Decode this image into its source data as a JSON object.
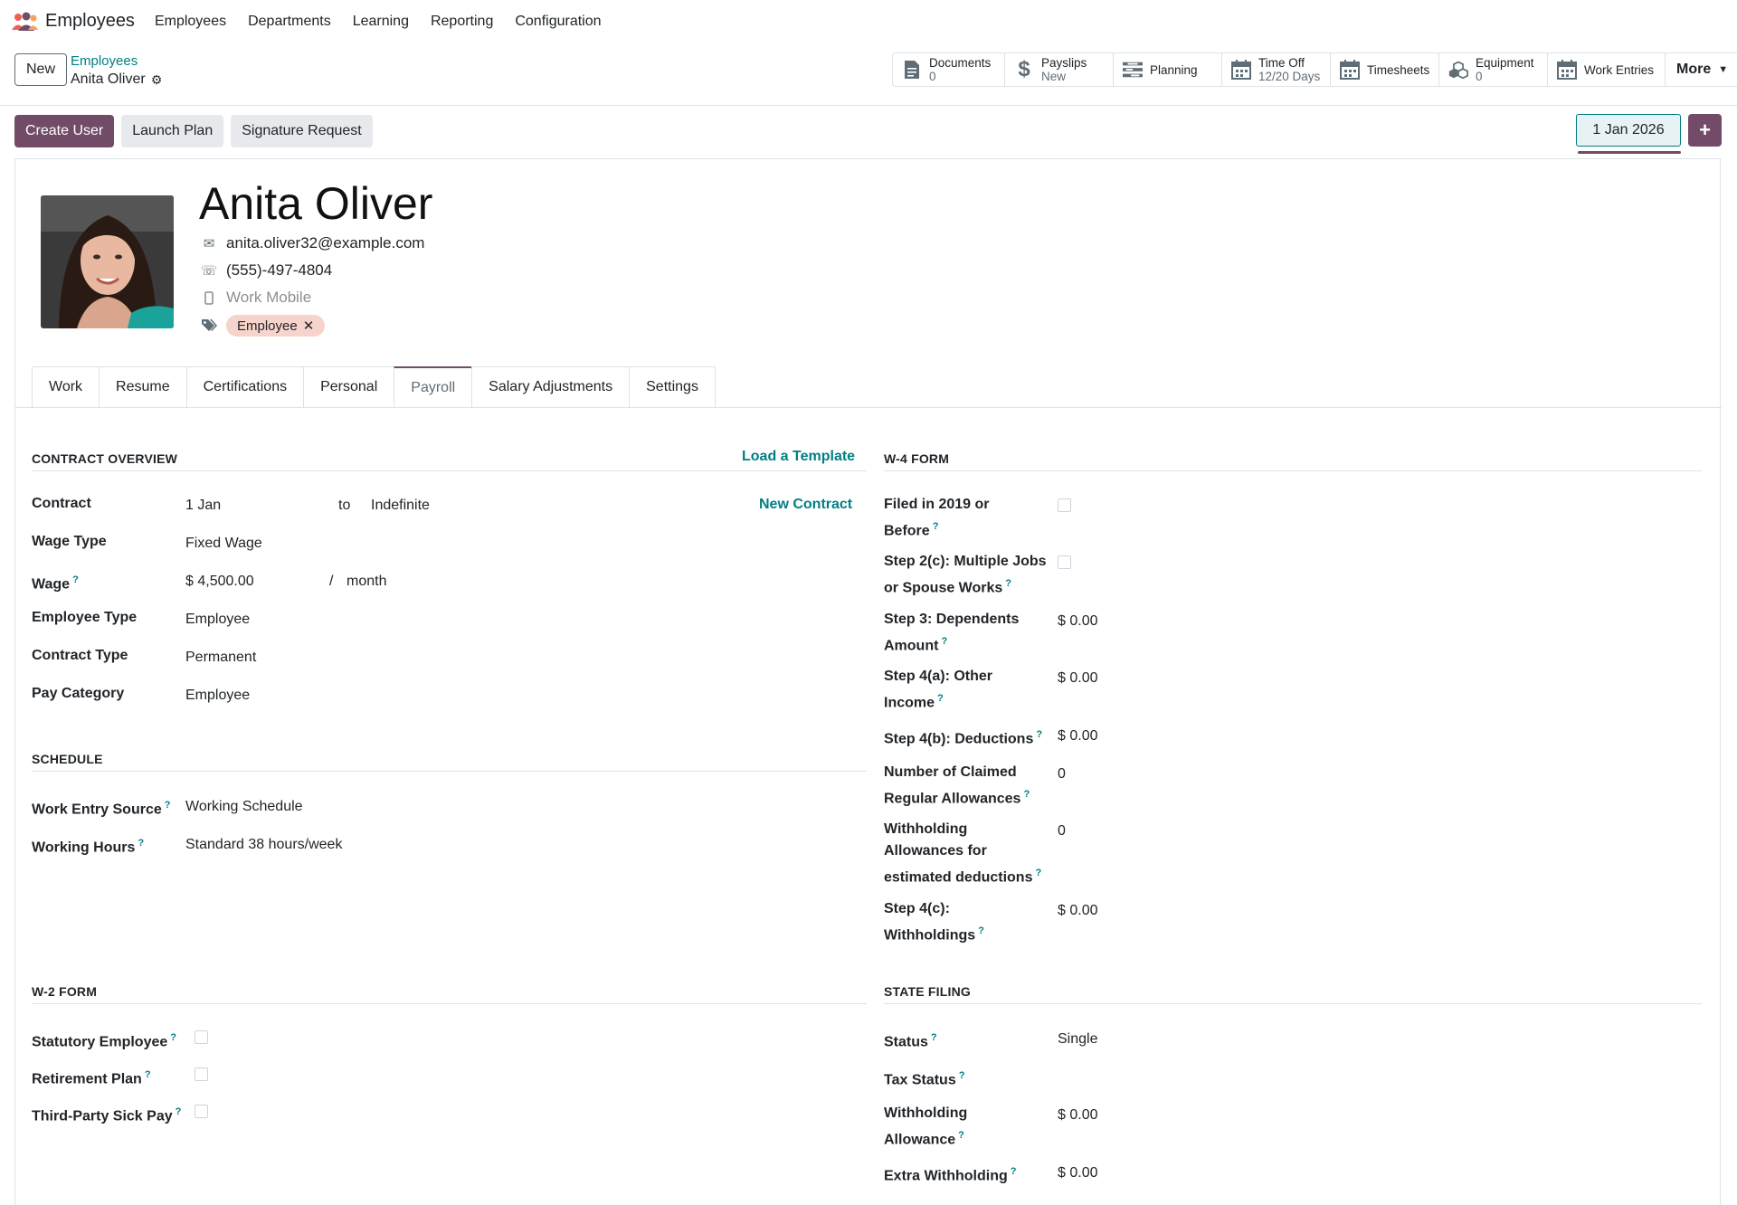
{
  "app": {
    "title": "Employees"
  },
  "nav": [
    "Employees",
    "Departments",
    "Learning",
    "Reporting",
    "Configuration"
  ],
  "control": {
    "new_label": "New",
    "breadcrumb_parent": "Employees",
    "breadcrumb_current": "Anita Oliver"
  },
  "smart_buttons": [
    {
      "label": "Documents",
      "value": "0",
      "icon": "document-icon"
    },
    {
      "label": "Payslips",
      "value": "New",
      "icon": "dollar-icon"
    },
    {
      "label": "Planning",
      "value": "",
      "icon": "planning-icon"
    },
    {
      "label": "Time Off",
      "value": "12/20 Days",
      "icon": "calendar-icon"
    },
    {
      "label": "Timesheets",
      "value": "",
      "icon": "calendar-icon"
    },
    {
      "label": "Equipment",
      "value": "0",
      "icon": "cubes-icon"
    },
    {
      "label": "Work Entries",
      "value": "",
      "icon": "calendar-icon"
    },
    {
      "label": "More",
      "value": "",
      "icon": "caret-down-icon"
    }
  ],
  "actions": {
    "create_user": "Create User",
    "launch_plan": "Launch Plan",
    "signature_request": "Signature Request",
    "date": "1 Jan 2026",
    "plus": "+"
  },
  "employee": {
    "name": "Anita Oliver",
    "email": "anita.oliver32@example.com",
    "phone": "(555)-497-4804",
    "mobile_placeholder": "Work Mobile",
    "tag": "Employee",
    "tag_remove": "✕"
  },
  "tabs": [
    "Work",
    "Resume",
    "Certifications",
    "Personal",
    "Payroll",
    "Salary Adjustments",
    "Settings"
  ],
  "active_tab": "Payroll",
  "contract_overview": {
    "title": "CONTRACT OVERVIEW",
    "load_template": "Load a Template",
    "new_contract": "New Contract",
    "contract_label": "Contract",
    "contract_start": "1 Jan",
    "contract_to": "to",
    "contract_end_placeholder": "Indefinite",
    "wage_type_label": "Wage Type",
    "wage_type": "Fixed Wage",
    "wage_label": "Wage",
    "wage": "$ 4,500.00",
    "wage_sep": "/",
    "wage_period": "month",
    "employee_type_label": "Employee Type",
    "employee_type": "Employee",
    "contract_type_label": "Contract Type",
    "contract_type": "Permanent",
    "pay_category_label": "Pay Category",
    "pay_category": "Employee"
  },
  "schedule": {
    "title": "SCHEDULE",
    "work_entry_source_label": "Work Entry Source",
    "work_entry_source": "Working Schedule",
    "working_hours_label": "Working Hours",
    "working_hours": "Standard 38 hours/week"
  },
  "w2": {
    "title": "W-2 FORM",
    "statutory_label": "Statutory Employee",
    "retirement_label": "Retirement Plan",
    "sick_pay_label": "Third-Party Sick Pay"
  },
  "w4": {
    "title": "W-4 FORM",
    "filed_label_1": "Filed in 2019 or",
    "filed_label_2": "Before",
    "step2c_label_1": "Step 2(c): Multiple Jobs",
    "step2c_label_2": "or Spouse Works",
    "step3_label_1": "Step 3: Dependents",
    "step3_label_2": "Amount",
    "step3": "$ 0.00",
    "step4a_label_1": "Step 4(a): Other",
    "step4a_label_2": "Income",
    "step4a": "$ 0.00",
    "step4b_label": "Step 4(b): Deductions",
    "step4b": "$ 0.00",
    "claimed_label_1": "Number of Claimed",
    "claimed_label_2": "Regular Allowances",
    "claimed": "0",
    "withholding_label_1": "Withholding",
    "withholding_label_2": "Allowances for",
    "withholding_label_3": "estimated deductions",
    "withholding": "0",
    "step4c_label_1": "Step 4(c):",
    "step4c_label_2": "Withholdings",
    "step4c": "$ 0.00"
  },
  "state_filing": {
    "title": "STATE FILING",
    "status_label": "Status",
    "status": "Single",
    "tax_status_label": "Tax Status",
    "allowance_label_1": "Withholding",
    "allowance_label_2": "Allowance",
    "allowance": "$ 0.00",
    "extra_label": "Extra Withholding",
    "extra": "$ 0.00"
  },
  "help_mark": "?",
  "colors": {
    "brand": "#714b67",
    "link": "#017e84",
    "tag_bg": "#f7d4cb"
  }
}
